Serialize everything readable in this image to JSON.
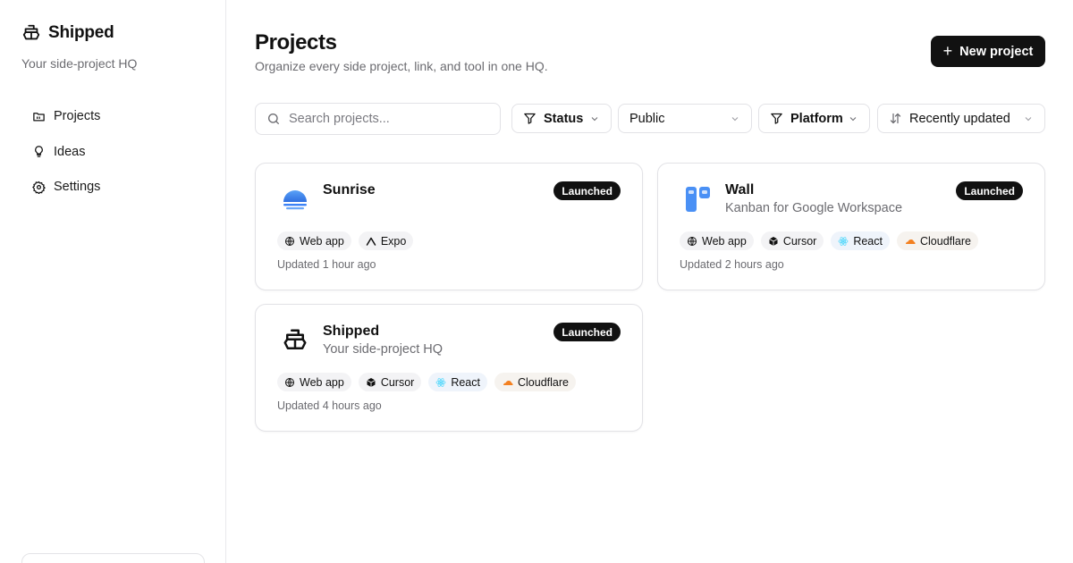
{
  "sidebar": {
    "brand_name": "Shipped",
    "tagline": "Your side-project HQ",
    "items": [
      {
        "label": "Projects",
        "icon": "folder-icon"
      },
      {
        "label": "Ideas",
        "icon": "lightbulb-icon"
      },
      {
        "label": "Settings",
        "icon": "gear-icon"
      }
    ]
  },
  "header": {
    "title": "Projects",
    "subtitle": "Organize every side project, link, and tool in one HQ.",
    "new_button_label": "New project"
  },
  "toolbar": {
    "search_placeholder": "Search projects...",
    "status_label": "Status",
    "visibility_value": "Public",
    "platform_label": "Platform",
    "sort_value": "Recently updated"
  },
  "projects": [
    {
      "title": "Sunrise",
      "description": "",
      "status": "Launched",
      "tags": [
        "Web app",
        "Expo"
      ],
      "updated": "Updated 1 hour ago"
    },
    {
      "title": "Wall",
      "description": "Kanban for Google Workspace",
      "status": "Launched",
      "tags": [
        "Web app",
        "Cursor",
        "React",
        "Cloudflare"
      ],
      "updated": "Updated 2 hours ago"
    },
    {
      "title": "Shipped",
      "description": "Your side-project HQ",
      "status": "Launched",
      "tags": [
        "Web app",
        "Cursor",
        "React",
        "Cloudflare"
      ],
      "updated": "Updated 4 hours ago"
    }
  ],
  "colors": {
    "primary": "#111111",
    "muted_text": "#6b6b70",
    "border": "#e2e2e6",
    "sunrise_blue": "#3b82f6",
    "wall_blue": "#4a90f5",
    "cloudflare_orange": "#f38020",
    "react_blue": "#61dafb"
  }
}
